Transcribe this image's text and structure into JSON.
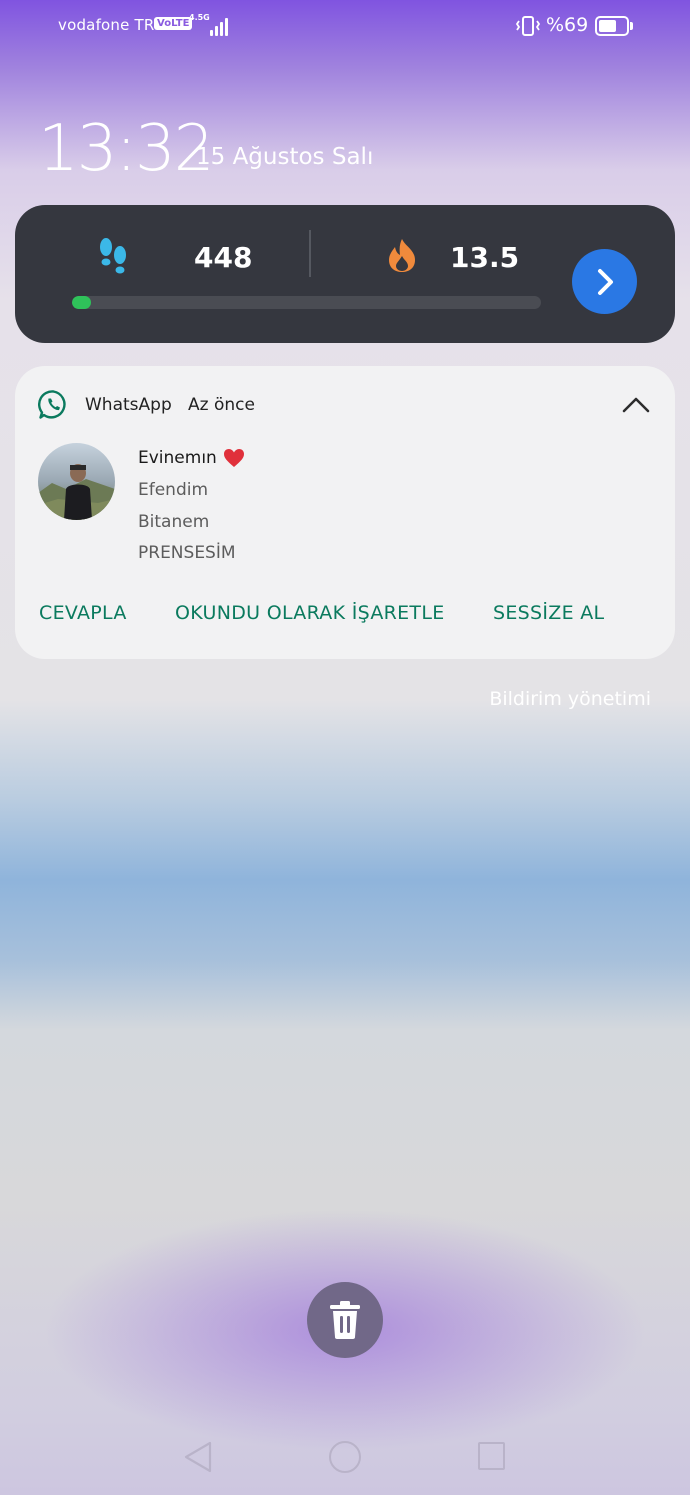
{
  "status_bar": {
    "carrier": "vodafone TR",
    "volte": "VoLTE",
    "network_type": "4.5G",
    "battery_percent": "%69",
    "battery_level": 0.69
  },
  "lockscreen": {
    "time": "13:32",
    "date": "15 Ağustos Salı"
  },
  "health_widget": {
    "steps": "448",
    "calories": "13.5",
    "progress_fraction": 0.04,
    "colors": {
      "card": "#35373f",
      "progress": "#2fc25a",
      "button": "#2a78e4",
      "steps_icon": "#3bb8e8",
      "flame_icon": "#f08a3c"
    }
  },
  "notification": {
    "app_name": "WhatsApp",
    "time": "Az önce",
    "sender": "Evinemın",
    "messages": [
      "Efendim",
      "Bitanem",
      "PRENSESİM"
    ],
    "actions": {
      "reply": "CEVAPLA",
      "mark_read": "OKUNDU OLARAK İŞARETLE",
      "mute": "SESSİZE AL"
    },
    "accent_color": "#0b7a5e"
  },
  "manage_notifications": "Bildirim yönetimi"
}
